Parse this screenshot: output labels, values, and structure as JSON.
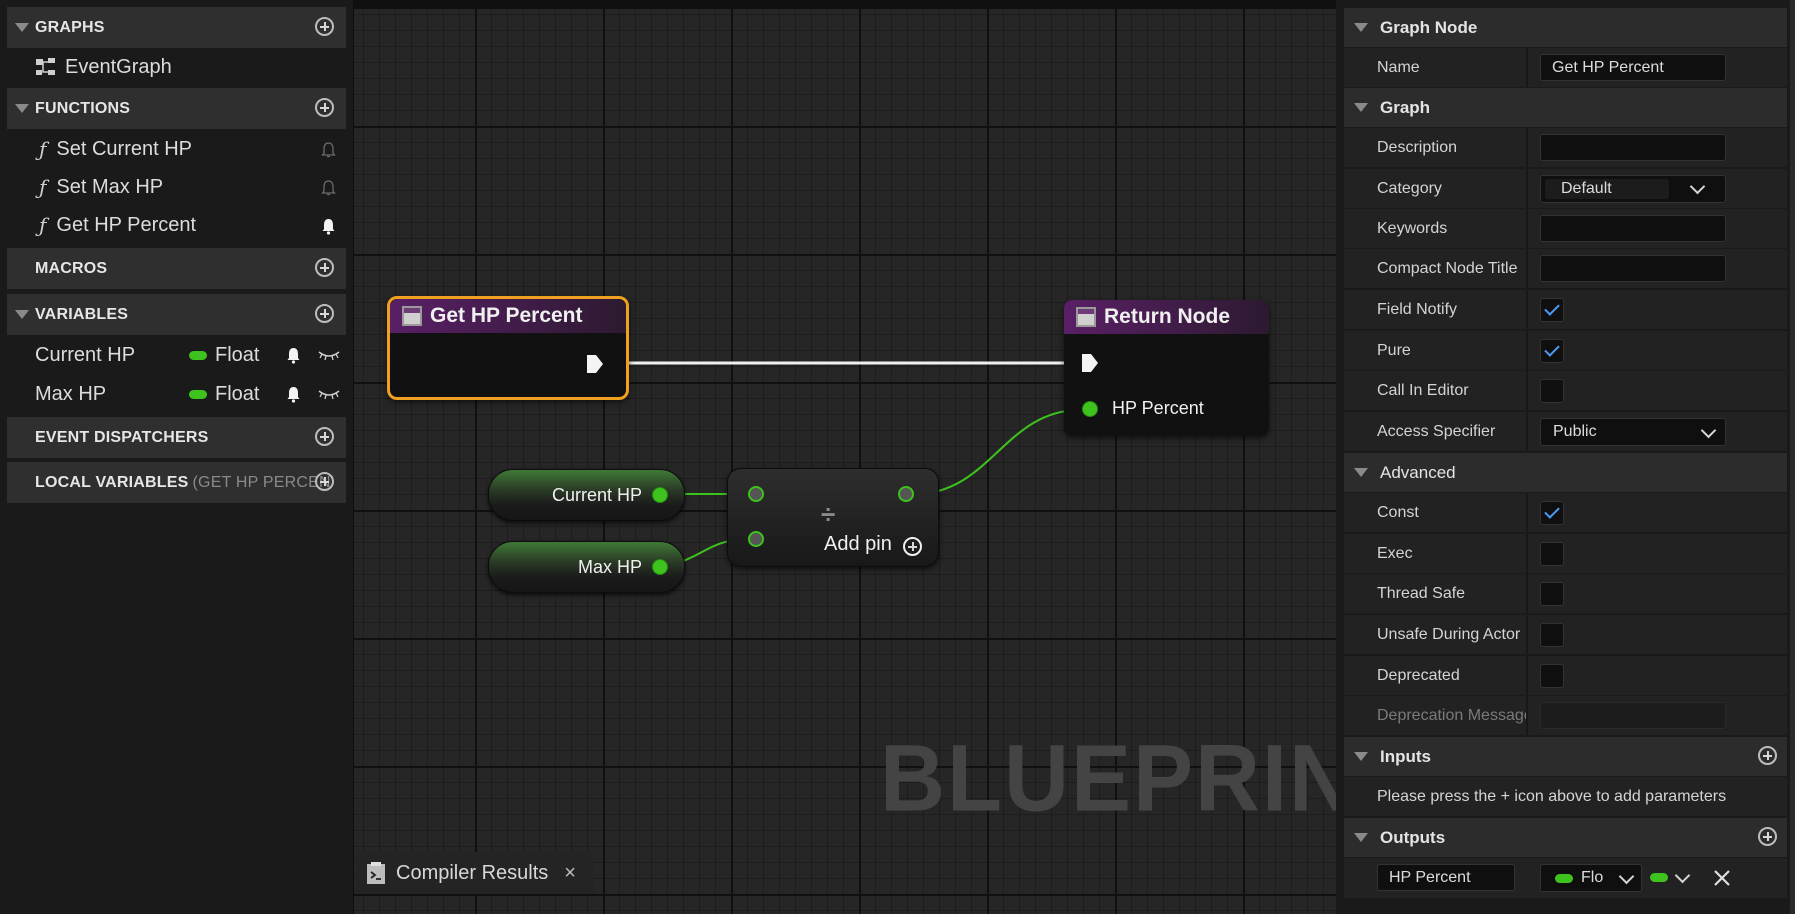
{
  "left_panel": {
    "graphs": {
      "label": "GRAPHS",
      "items": [
        "EventGraph"
      ]
    },
    "functions": {
      "label": "FUNCTIONS",
      "items": [
        "Set Current HP",
        "Set Max HP",
        "Get HP Percent"
      ]
    },
    "function_glyph": "ƒ",
    "macros": {
      "label": "MACROS"
    },
    "variables": {
      "label": "VARIABLES",
      "items": [
        {
          "name": "Current HP",
          "type": "Float"
        },
        {
          "name": "Max HP",
          "type": "Float"
        }
      ]
    },
    "event_dispatchers": {
      "label": "EVENT DISPATCHERS"
    },
    "local_variables": {
      "label": "LOCAL VARIABLES",
      "sub": "(GET HP PERCENT"
    }
  },
  "graph": {
    "entry_node": {
      "title": "Get HP Percent"
    },
    "return_node": {
      "title": "Return Node",
      "output_pin": "HP Percent"
    },
    "var_current": "Current HP",
    "var_max": "Max HP",
    "divide_node": {
      "symbol": "÷",
      "add_pin": "Add pin"
    },
    "watermark": "BLUEPRINT",
    "bottom_tab": {
      "label": "Compiler Results",
      "close": "×"
    }
  },
  "details": {
    "graph_node_section": "Graph Node",
    "name": {
      "label": "Name",
      "value": "Get HP Percent"
    },
    "graph_section": "Graph",
    "description": {
      "label": "Description",
      "value": ""
    },
    "category": {
      "label": "Category",
      "value": "Default"
    },
    "keywords": {
      "label": "Keywords",
      "value": ""
    },
    "compact_node_title": {
      "label": "Compact Node Title",
      "value": ""
    },
    "field_notify": {
      "label": "Field Notify",
      "checked": true
    },
    "pure": {
      "label": "Pure",
      "checked": true
    },
    "call_in_editor": {
      "label": "Call In Editor",
      "checked": false
    },
    "access_specifier": {
      "label": "Access Specifier",
      "value": "Public"
    },
    "advanced_section": "Advanced",
    "const": {
      "label": "Const",
      "checked": true
    },
    "exec": {
      "label": "Exec",
      "checked": false
    },
    "thread_safe": {
      "label": "Thread Safe",
      "checked": false
    },
    "unsafe_during_actor": {
      "label": "Unsafe During Actor",
      "checked": false
    },
    "deprecated": {
      "label": "Deprecated",
      "checked": false
    },
    "deprecation_message": {
      "label": "Deprecation Message",
      "value": ""
    },
    "inputs_section": "Inputs",
    "inputs_hint": "Please press the + icon above to add parameters",
    "outputs_section": "Outputs",
    "output_param": {
      "name": "HP Percent",
      "type": "Flo"
    }
  },
  "colors": {
    "float_pin": "#3ec21e",
    "function_header": "#5a1f66",
    "selection": "#f0a020",
    "checkbox_check": "#4a9cf6"
  }
}
